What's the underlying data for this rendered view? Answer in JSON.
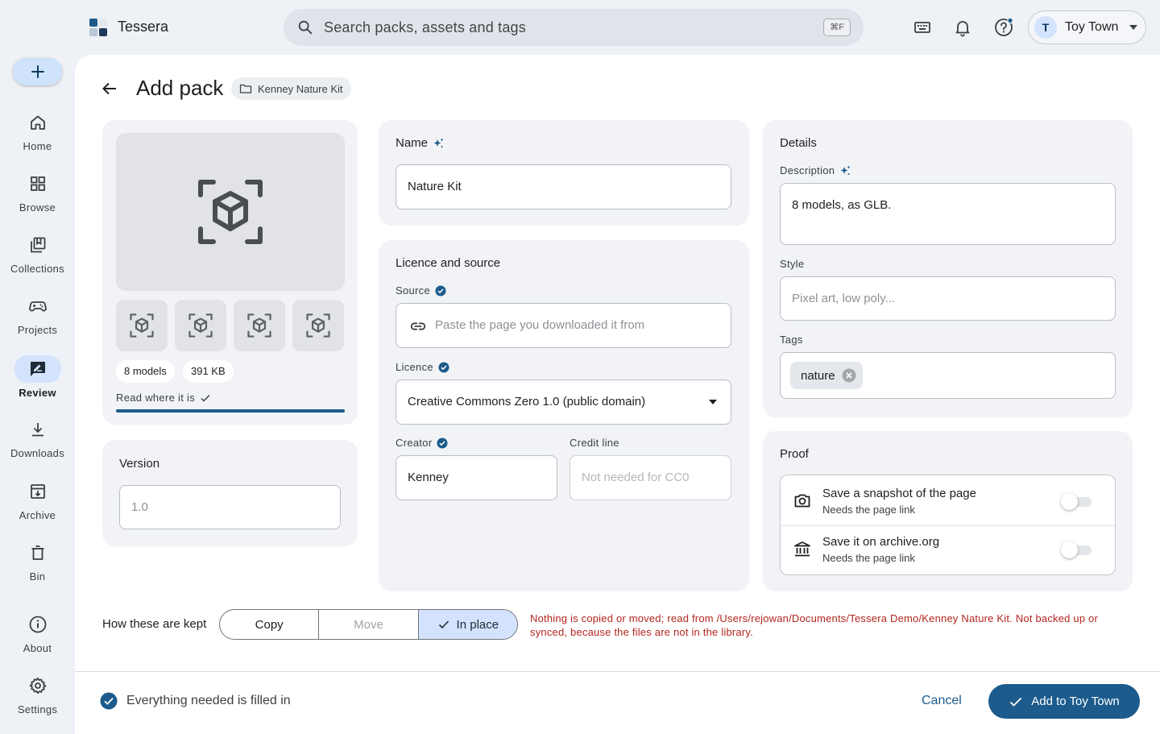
{
  "app": {
    "name": "Tessera"
  },
  "search": {
    "placeholder": "Search packs, assets and tags",
    "shortcut": "⌘F"
  },
  "topbar": {
    "icons": [
      "keyboard-icon",
      "bell-icon",
      "help-icon"
    ]
  },
  "account": {
    "initial": "T",
    "name": "Toy Town"
  },
  "rail": {
    "items": [
      {
        "label": "Home",
        "icon": "home-icon"
      },
      {
        "label": "Browse",
        "icon": "grid-icon"
      },
      {
        "label": "Collections",
        "icon": "collections-icon"
      },
      {
        "label": "Projects",
        "icon": "gamepad-icon"
      },
      {
        "label": "Review",
        "icon": "review-icon",
        "active": true
      },
      {
        "label": "Downloads",
        "icon": "download-icon"
      },
      {
        "label": "Archive",
        "icon": "archive-icon"
      },
      {
        "label": "Bin",
        "icon": "trash-icon"
      },
      {
        "label": "About",
        "icon": "info-icon"
      },
      {
        "label": "Settings",
        "icon": "gear-icon"
      }
    ]
  },
  "page": {
    "title": "Add pack",
    "folder_chip": "Kenney Nature Kit"
  },
  "preview": {
    "models_chip": "8 models",
    "size_chip": "391 KB",
    "read_status": "Read where it is",
    "read_progress": 1.0
  },
  "version": {
    "title": "Version",
    "placeholder": "1.0"
  },
  "name_card": {
    "title": "Name",
    "value": "Nature Kit"
  },
  "licence": {
    "title": "Licence and source",
    "source_label": "Source",
    "source_placeholder": "Paste the page you downloaded it from",
    "licence_label": "Licence",
    "licence_value": "Creative Commons Zero 1.0 (public domain)",
    "creator_label": "Creator",
    "creator_value": "Kenney",
    "credit_label": "Credit line",
    "credit_placeholder": "Not needed for CC0"
  },
  "details": {
    "title": "Details",
    "description_label": "Description",
    "description_value": "8 models, as GLB.",
    "style_label": "Style",
    "style_placeholder": "Pixel art, low poly...",
    "tags_label": "Tags",
    "tags": [
      "nature"
    ]
  },
  "proof": {
    "title": "Proof",
    "items": [
      {
        "title": "Save a snapshot of the page",
        "subtitle": "Needs the page link",
        "icon": "camera-icon",
        "on": false
      },
      {
        "title": "Save it on archive.org",
        "subtitle": "Needs the page link",
        "icon": "museum-icon",
        "on": false
      }
    ]
  },
  "storage": {
    "label": "How these are kept",
    "options": [
      "Copy",
      "Move",
      "In place"
    ],
    "selected": "In place",
    "note": "Nothing is copied or moved; read from /Users/rejowan/Documents/Tessera Demo/Kenney Nature Kit. Not backed up or synced, because the files are not in the library."
  },
  "footer": {
    "status": "Everything needed is filled in",
    "cancel": "Cancel",
    "submit": "Add to Toy Town"
  },
  "colors": {
    "accent": "#1c5b8c",
    "error_text": "#b3261e",
    "selected_bg": "#d3e3fd"
  }
}
